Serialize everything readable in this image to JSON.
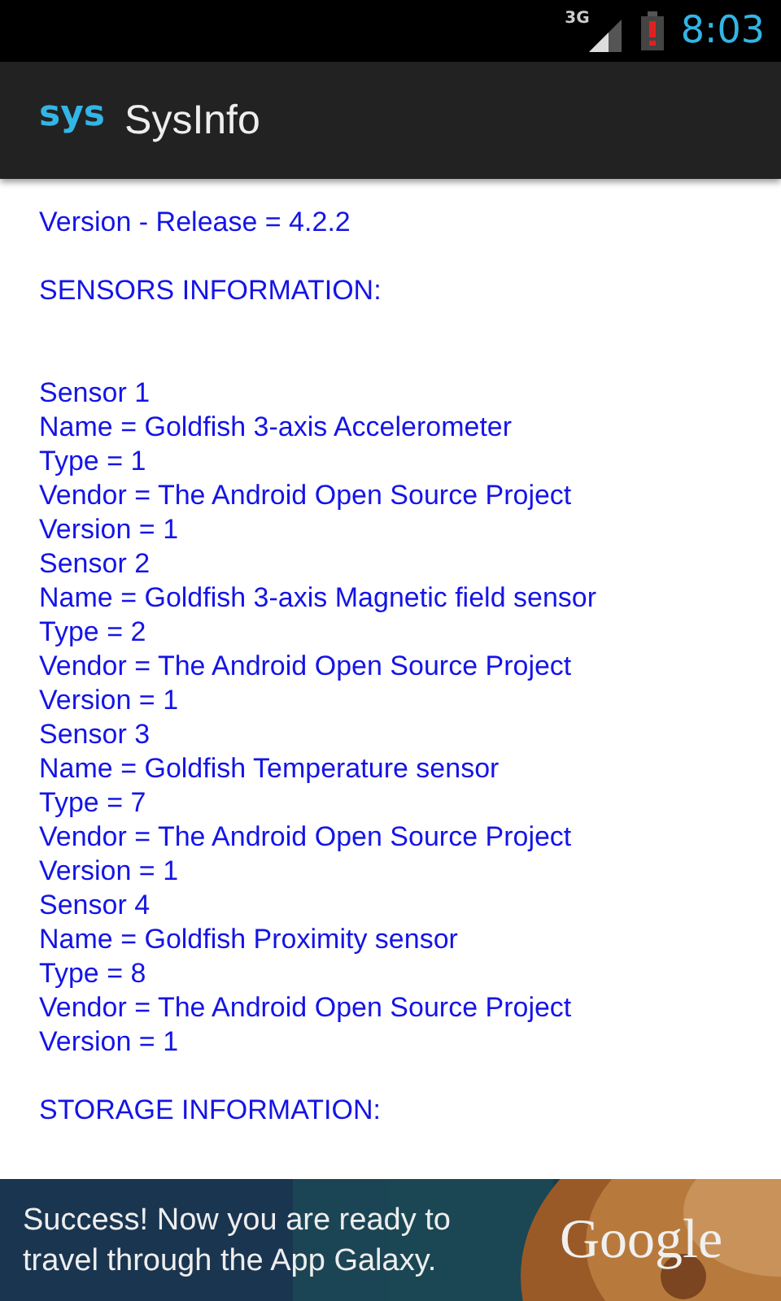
{
  "status_bar": {
    "network": "3G",
    "time": "8:03"
  },
  "action_bar": {
    "logo": "sys",
    "title": "SysInfo"
  },
  "content": {
    "release_line": "Version - Release = 4.2.2",
    "sensors_heading": "SENSORS INFORMATION:",
    "sensors": [
      {
        "lines": [
          "Sensor 1",
          "Name = Goldfish 3-axis Accelerometer",
          "Type = 1",
          "Vendor = The Android Open Source Project",
          "Version = 1"
        ]
      },
      {
        "lines": [
          "Sensor 2",
          "Name = Goldfish 3-axis Magnetic field sensor",
          "Type = 2",
          "Vendor = The Android Open Source Project",
          "Version = 1"
        ]
      },
      {
        "lines": [
          "Sensor 3",
          "Name = Goldfish Temperature sensor",
          "Type = 7",
          "Vendor = The Android Open Source Project",
          "Version = 1"
        ]
      },
      {
        "lines": [
          "Sensor 4",
          "Name = Goldfish Proximity sensor",
          "Type = 8",
          "Vendor = The Android Open Source Project",
          "Version = 1"
        ]
      }
    ],
    "storage_heading": "STORAGE INFORMATION:"
  },
  "ad_banner": {
    "text": "Success! Now you are ready to travel through the App Galaxy.",
    "brand": "Google"
  }
}
